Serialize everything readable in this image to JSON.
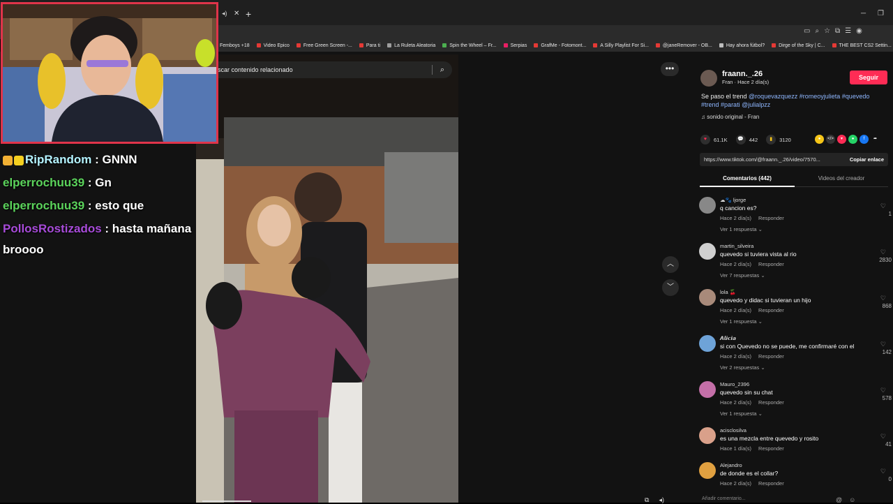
{
  "browser": {
    "bookmarks": [
      {
        "label": "Femboys +18",
        "color": "#8a8a8a"
      },
      {
        "label": "Video Epico",
        "color": "#e53935"
      },
      {
        "label": "Free Green Screen -...",
        "color": "#e53935"
      },
      {
        "label": "Para ti",
        "color": "#e53935"
      },
      {
        "label": "La Ruleta Aleatoria",
        "color": "#9e9e9e"
      },
      {
        "label": "Spin the Wheel – Fr...",
        "color": "#4caf50"
      },
      {
        "label": "Serpias",
        "color": "#e91e63"
      },
      {
        "label": "GrafMe - Fotomont...",
        "color": "#e53935"
      },
      {
        "label": "A Silly Playlist For Si...",
        "color": "#e53935"
      },
      {
        "label": "@janeRemover - OB...",
        "color": "#e53935"
      },
      {
        "label": "Hay ahora fútbol?",
        "color": "#bdbdbd"
      },
      {
        "label": "Dirge of the Sky | C...",
        "color": "#e53935"
      },
      {
        "label": "THE BEST CS2 Settin...",
        "color": "#e53935"
      }
    ]
  },
  "search": {
    "placeholder": "scar contenido relacionado"
  },
  "chat": [
    {
      "user": "RipRandom",
      "text": ": GNNN"
    },
    {
      "user": "elperrochuu39",
      "text": ": Gn"
    },
    {
      "user": "elperrochuu39",
      "text": ": esto que"
    },
    {
      "user": "PollosRostizados",
      "text": ": hasta mañana",
      "cont": "broooo"
    }
  ],
  "post": {
    "author": "fraann._.26",
    "author_sub": "Fran · Hace 2 día(s)",
    "follow_label": "Seguir",
    "desc_plain": "Se paso el trend ",
    "desc_tags": [
      "@roquevazquezz",
      "#romeoyjulieta",
      "#quevedo",
      "#trend",
      "#parati",
      "@julialpzz"
    ],
    "sound": "sonido original - Fran",
    "likes": "61.1K",
    "comments": "442",
    "saves": "3120",
    "link": "https://www.tiktok.com/@fraann._.26/video/7570...",
    "copy_label": "Copiar enlace",
    "tab_comments": "Comentarios (442)",
    "tab_creator": "Videos del creador",
    "add_comment": "Añadir comentario..."
  },
  "comments": [
    {
      "name": "☁🐾 ljorge",
      "text": "q cancion es?",
      "time": "Hace 2 día(s)",
      "reply": "Responder",
      "replies": "Ver 1 respuesta ⌄",
      "count": "1",
      "color": "#888"
    },
    {
      "name": "martin_silveira",
      "text": "quevedo si tuviera vista al rio",
      "time": "Hace 2 día(s)",
      "reply": "Responder",
      "replies": "Ver 7 respuestas ⌄",
      "count": "2830",
      "color": "#cfcfcf"
    },
    {
      "name": "lola 🍒",
      "text": "quevedo y didac si tuvieran un hijo",
      "time": "Hace 2 día(s)",
      "reply": "Responder",
      "replies": "Ver 1 respuesta ⌄",
      "count": "868",
      "color": "#a88a7a"
    },
    {
      "name": "𝘼𝙡𝙞𝙘𝙞𝙖",
      "text": "si con Quevedo no se puede, me confirmaré con el",
      "time": "Hace 2 día(s)",
      "reply": "Responder",
      "replies": "Ver 2 respuestas ⌄",
      "count": "142",
      "color": "#6ea3d8"
    },
    {
      "name": "Mauro_2396",
      "text": "quevedo sin su chat",
      "time": "Hace 2 día(s)",
      "reply": "Responder",
      "replies": "Ver 1 respuesta ⌄",
      "count": "578",
      "color": "#c46fa8"
    },
    {
      "name": "acisclosilva",
      "text": "es una mezcla entre quevedo y rosito",
      "time": "Hace 1 día(s)",
      "reply": "Responder",
      "replies": "",
      "count": "41",
      "color": "#d9a08a"
    },
    {
      "name": "Alejandro",
      "text": "de donde es el collar?",
      "time": "Hace 2 día(s)",
      "reply": "Responder",
      "replies": "",
      "count": "0",
      "color": "#e0a040"
    }
  ]
}
